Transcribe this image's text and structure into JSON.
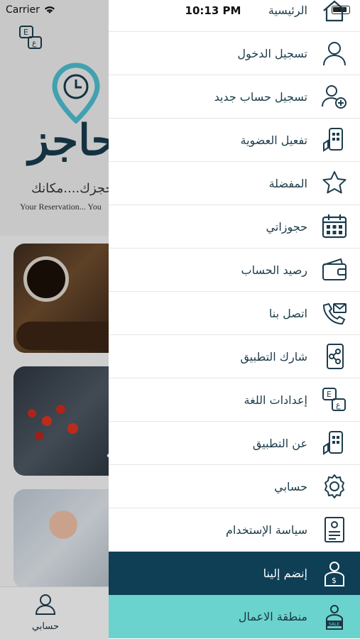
{
  "status_bar": {
    "carrier": "Carrier",
    "time": "10:13 PM"
  },
  "background": {
    "logo_text": "حاجز",
    "tagline_ar": "حجزك....مكانك",
    "tagline_en": "Your Reservation... You",
    "card_label": "حة",
    "bottom_tab_label": "حسابي"
  },
  "drawer": {
    "items": [
      {
        "label": "الرئيسية",
        "icon": "home-icon"
      },
      {
        "label": "تسجيل الدخول",
        "icon": "user-icon"
      },
      {
        "label": "تسجيل حساب جديد",
        "icon": "add-user-icon"
      },
      {
        "label": "تفعيل العضوية",
        "icon": "membership-icon"
      },
      {
        "label": "المفضلة",
        "icon": "star-icon"
      },
      {
        "label": "حجوزاتي",
        "icon": "calendar-icon"
      },
      {
        "label": "رصيد الحساب",
        "icon": "wallet-icon"
      },
      {
        "label": "اتصل بنا",
        "icon": "phone-mail-icon"
      },
      {
        "label": "شارك التطبيق",
        "icon": "share-icon"
      },
      {
        "label": "إعدادات اللغة",
        "icon": "language-icon"
      },
      {
        "label": "عن التطبيق",
        "icon": "about-app-icon"
      },
      {
        "label": "حسابي",
        "icon": "gear-icon"
      },
      {
        "label": "سياسة الإستخدام",
        "icon": "policy-icon"
      },
      {
        "label": "إنضم إلينا",
        "icon": "join-icon"
      },
      {
        "label": "منطقة الاعمال",
        "icon": "sale-icon"
      }
    ]
  },
  "colors": {
    "primary": "#0e3f55",
    "accent": "#6ad3cd",
    "icon": "#1c3c4c"
  }
}
